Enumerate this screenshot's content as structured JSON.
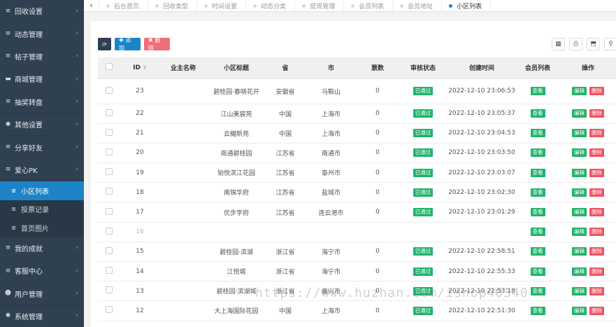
{
  "sidebar": {
    "items": [
      {
        "icon": "list-icon",
        "label": "回收设置",
        "glyph": "≡"
      },
      {
        "icon": "list-icon",
        "label": "动态管理",
        "glyph": "≡"
      },
      {
        "icon": "list-icon",
        "label": "帖子管理",
        "glyph": "≡"
      },
      {
        "icon": "cart-icon",
        "label": "商城管理",
        "glyph": "▬"
      },
      {
        "icon": "list-icon",
        "label": "抽奖转盘",
        "glyph": "≡"
      },
      {
        "icon": "gear-icon",
        "label": "其他设置",
        "glyph": "✱"
      },
      {
        "icon": "list-icon",
        "label": "分享好友",
        "glyph": "≡"
      },
      {
        "icon": "list-icon",
        "label": "爱心PK",
        "glyph": "≡"
      }
    ],
    "sub_items": [
      {
        "label": "小区列表",
        "active": true
      },
      {
        "label": "投票记录",
        "active": false
      },
      {
        "label": "首页图片",
        "active": false
      }
    ],
    "bottom_items": [
      {
        "icon": "list-icon",
        "label": "我的成就",
        "glyph": "≡"
      },
      {
        "icon": "list-icon",
        "label": "客服中心",
        "glyph": "≡"
      },
      {
        "icon": "users-icon",
        "label": "用户管理",
        "glyph": "☻"
      },
      {
        "icon": "gear-icon",
        "label": "系统管理",
        "glyph": "✱"
      }
    ]
  },
  "tabs": {
    "back_glyph": "‹",
    "items": [
      {
        "label": "后台首页",
        "active": false
      },
      {
        "label": "回收类型",
        "active": false
      },
      {
        "label": "时间设置",
        "active": false
      },
      {
        "label": "动态分类",
        "active": false
      },
      {
        "label": "提现管理",
        "active": false
      },
      {
        "label": "会员列表",
        "active": false
      },
      {
        "label": "会员地址",
        "active": false
      },
      {
        "label": "小区列表",
        "active": true
      }
    ]
  },
  "toolbar": {
    "refresh_glyph": "⟳",
    "add_label": "✚ 添加",
    "delete_label": "✖ 删除",
    "right_tools": [
      {
        "icon": "columns-icon",
        "glyph": "▦"
      },
      {
        "icon": "print-icon",
        "glyph": "⎙"
      },
      {
        "icon": "export-icon",
        "glyph": "⬒"
      },
      {
        "icon": "search-icon",
        "glyph": "⚲"
      }
    ]
  },
  "table": {
    "headers": [
      "",
      "ID",
      "业主名称",
      "小区标题",
      "省",
      "市",
      "票数",
      "审核状态",
      "创建时间",
      "会员列表",
      "操作"
    ],
    "sort_glyph": "⇕",
    "status_label": "已通过",
    "view_label": "查看",
    "edit_label": "编辑",
    "delete_label": "删除",
    "rows": [
      {
        "id": "23",
        "owner": "",
        "title": "碧桂园·春晓花开",
        "province": "安徽省",
        "city": "马鞍山",
        "votes": "0",
        "created": "2022-12-10 23:06:53"
      },
      {
        "id": "22",
        "owner": "",
        "title": "江山美宸苑",
        "province": "中国",
        "city": "上海市",
        "votes": "0",
        "created": "2022-12-10 23:05:37"
      },
      {
        "id": "21",
        "owner": "",
        "title": "云樾新苑",
        "province": "中国",
        "city": "上海市",
        "votes": "0",
        "created": "2022-12-10 23:04:53"
      },
      {
        "id": "20",
        "owner": "",
        "title": "南通碧桂园",
        "province": "江苏省",
        "city": "南通市",
        "votes": "0",
        "created": "2022-12-10 23:03:50"
      },
      {
        "id": "19",
        "owner": "",
        "title": "铂悦滨江花园",
        "province": "江苏省",
        "city": "泰州市",
        "votes": "0",
        "created": "2022-12-10 23:03:07"
      },
      {
        "id": "18",
        "owner": "",
        "title": "南锦华府",
        "province": "江苏省",
        "city": "盐城市",
        "votes": "0",
        "created": "2022-12-10 23:02:30"
      },
      {
        "id": "17",
        "owner": "",
        "title": "优步学府",
        "province": "江苏省",
        "city": "连云港市",
        "votes": "0",
        "created": "2022-12-10 23:01:29"
      },
      {
        "id": "16",
        "owner": "",
        "title": "",
        "province": "",
        "city": "",
        "votes": "",
        "created": ""
      },
      {
        "id": "15",
        "owner": "",
        "title": "碧桂园·滨湖",
        "province": "浙江省",
        "city": "海宁市",
        "votes": "0",
        "created": "2022-12-10 22:58:51"
      },
      {
        "id": "14",
        "owner": "",
        "title": "江悦城",
        "province": "浙江省",
        "city": "海宁市",
        "votes": "0",
        "created": "2022-12-10 22:55:33"
      },
      {
        "id": "13",
        "owner": "",
        "title": "碧桂园·滨湖城",
        "province": "浙江省",
        "city": "嘉兴市",
        "votes": "0",
        "created": "2022-12-10 22:53:18"
      },
      {
        "id": "12",
        "owner": "",
        "title": "大上海国际花园",
        "province": "中国",
        "city": "上海市",
        "votes": "0",
        "created": "2022-12-10 22:51:30"
      }
    ]
  },
  "watermark": "https://www.huzhan.com/ishop40340",
  "colors": {
    "sidebar": "#2f4050",
    "accent": "#1c84c6",
    "success": "#21b36a",
    "danger": "#ed5565"
  }
}
